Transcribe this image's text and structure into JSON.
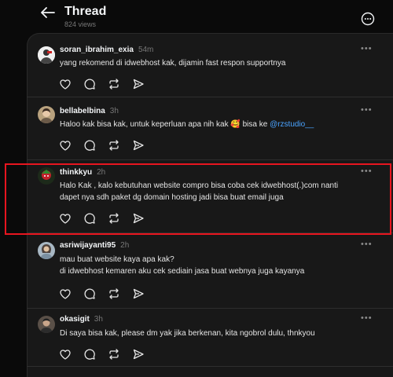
{
  "header": {
    "title": "Thread",
    "views": "824 views"
  },
  "posts": [
    {
      "username": "soran_ibrahim_exia",
      "time": "54m",
      "lines": [
        "yang rekomend di idwebhost kak, dijamin fast respon supportnya"
      ]
    },
    {
      "username": "bellabelbina",
      "time": "3h",
      "text_before": "Haloo kak bisa kak, untuk keperluan apa nih kak ",
      "emoji": "🥰",
      "text_after": " bisa ke ",
      "mention": "@rzstudio__"
    },
    {
      "username": "thinkkyu",
      "time": "2h",
      "lines": [
        "Halo Kak , kalo kebutuhan website compro bisa coba cek idwebhost(.)com nanti",
        "dapet nya sdh paket dg domain hosting jadi bisa buat email juga"
      ]
    },
    {
      "username": "asriwijayanti95",
      "time": "2h",
      "lines": [
        "mau buat website kaya apa kak?",
        "di idwebhost kemaren aku cek sediain jasa buat webnya juga kayanya"
      ]
    },
    {
      "username": "okasigit",
      "time": "3h",
      "lines": [
        "Di saya bisa kak, please dm yak jika berkenan, kita ngobrol dulu, thnkyou"
      ]
    }
  ],
  "more_label": "•••",
  "colors": {
    "background": "#0a0a0a",
    "panel": "#181818",
    "highlight": "#e8151f",
    "mention": "#4aa3ff"
  }
}
